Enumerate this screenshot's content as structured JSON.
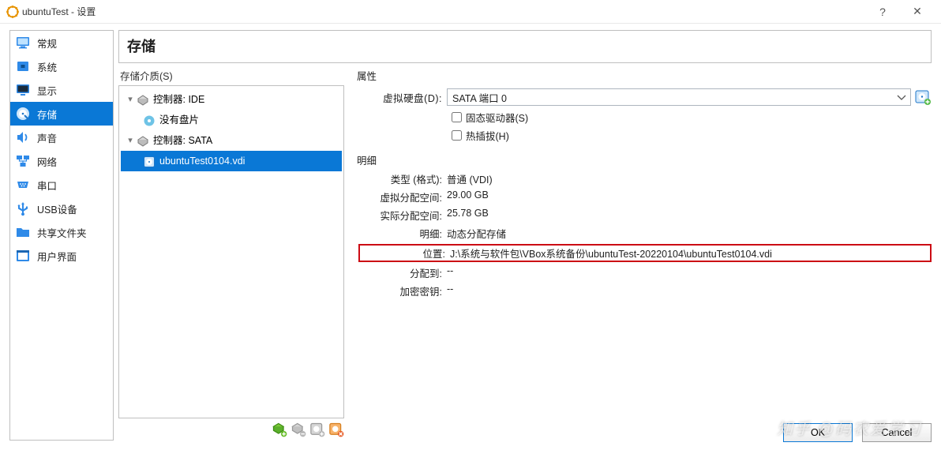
{
  "window": {
    "title": "ubuntuTest - 设置",
    "help": "?",
    "close": "✕"
  },
  "sidebar": {
    "items": [
      {
        "id": "general",
        "label": "常规"
      },
      {
        "id": "system",
        "label": "系统"
      },
      {
        "id": "display",
        "label": "显示"
      },
      {
        "id": "storage",
        "label": "存储",
        "selected": true
      },
      {
        "id": "audio",
        "label": "声音"
      },
      {
        "id": "network",
        "label": "网络"
      },
      {
        "id": "serial",
        "label": "串口"
      },
      {
        "id": "usb",
        "label": "USB设备"
      },
      {
        "id": "shared",
        "label": "共享文件夹"
      },
      {
        "id": "ui",
        "label": "用户界面"
      }
    ]
  },
  "page": {
    "title": "存储"
  },
  "storage": {
    "tree_label": "存储介质(S)",
    "controllers": [
      {
        "name": "控制器: IDE",
        "children": [
          {
            "name": "没有盘片",
            "kind": "disc"
          }
        ]
      },
      {
        "name": "控制器: SATA",
        "children": [
          {
            "name": "ubuntuTest0104.vdi",
            "kind": "hdd",
            "selected": true
          }
        ]
      }
    ]
  },
  "attrs": {
    "section": "属性",
    "hdd": {
      "label": "虚拟硬盘(D):",
      "value": "SATA 端口 0"
    },
    "ssd": {
      "label": "固态驱动器(S)"
    },
    "hotplug": {
      "label": "热插拔(H)"
    }
  },
  "details": {
    "section": "明细",
    "rows": [
      {
        "label": "类型 (格式):",
        "value": "普通  (VDI)"
      },
      {
        "label": "虚拟分配空间:",
        "value": "29.00  GB"
      },
      {
        "label": "实际分配空间:",
        "value": "25.78  GB"
      },
      {
        "label": "明细:",
        "value": "动态分配存储"
      },
      {
        "label": "位置:",
        "value": "J:\\系统与软件包\\VBox系统备份\\ubuntuTest-20220104\\ubuntuTest0104.vdi",
        "highlight": true
      },
      {
        "label": "分配到:",
        "value": "--"
      },
      {
        "label": "加密密钥:",
        "value": "--"
      }
    ]
  },
  "footer": {
    "ok": "OK",
    "cancel": "Cancel"
  },
  "watermark": "知乎 @码农爱学习"
}
